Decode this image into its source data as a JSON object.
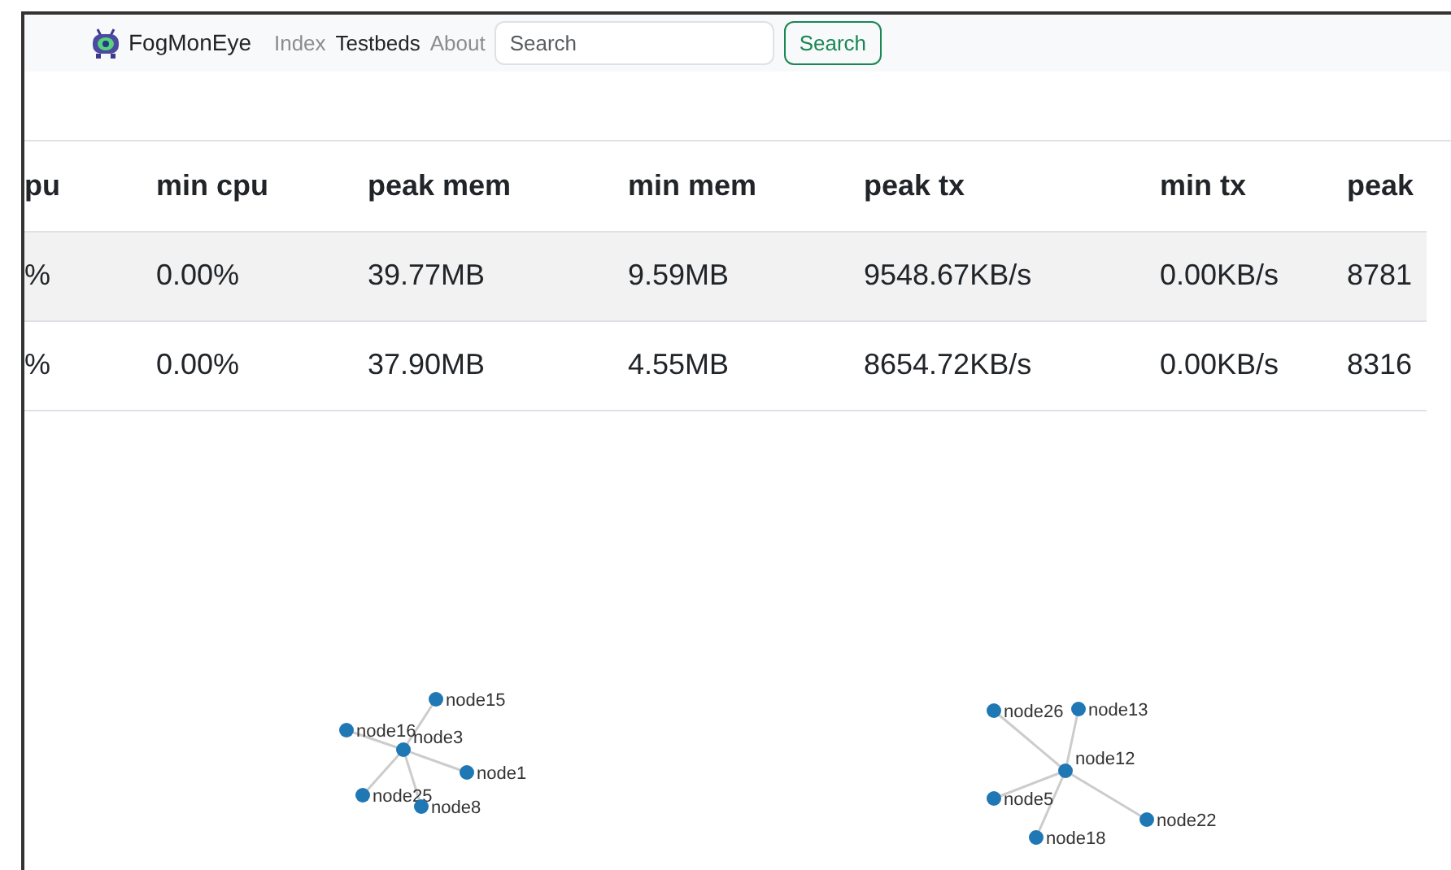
{
  "navbar": {
    "brand": "FogMonEye",
    "links": [
      {
        "label": "Index",
        "selected": false
      },
      {
        "label": "Testbeds",
        "selected": true
      },
      {
        "label": "About",
        "selected": false
      }
    ],
    "search": {
      "placeholder": "Search"
    },
    "search_button": "Search"
  },
  "table": {
    "columns": [
      "pu",
      "min cpu",
      "peak mem",
      "min mem",
      "peak tx",
      "min tx",
      "peak"
    ],
    "rows": [
      [
        "%",
        "0.00%",
        "39.77MB",
        "9.59MB",
        "9548.67KB/s",
        "0.00KB/s",
        "8781"
      ],
      [
        "%",
        "0.00%",
        "37.90MB",
        "4.55MB",
        "8654.72KB/s",
        "0.00KB/s",
        "8316"
      ]
    ]
  },
  "graphs": [
    {
      "hub": "node3",
      "nodes": [
        "node15",
        "node16",
        "node1",
        "node25",
        "node8"
      ]
    },
    {
      "hub": "node12",
      "nodes": [
        "node26",
        "node13",
        "node5",
        "node18",
        "node22"
      ]
    }
  ]
}
